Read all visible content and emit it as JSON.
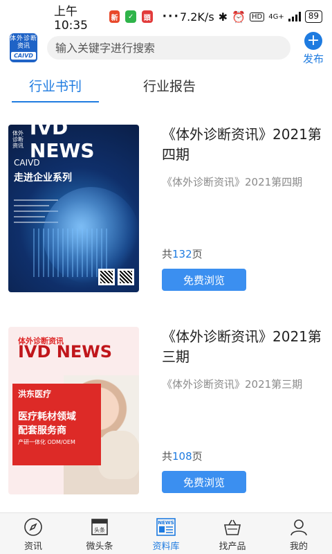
{
  "status_bar": {
    "time": "上午10:35",
    "app_icons": [
      {
        "name": "news-app-icon",
        "color": "#e8492b",
        "glyph": "新"
      },
      {
        "name": "wechat-icon",
        "color": "#2fb44a",
        "glyph": "✓"
      },
      {
        "name": "red-app-icon",
        "color": "#e23b3b",
        "glyph": "頭"
      }
    ],
    "more": "···",
    "net_speed": "7.2K/s",
    "hd": "HD",
    "network": "4G+",
    "battery": "89"
  },
  "header": {
    "logo_line1": "体外诊断",
    "logo_line2": "资讯",
    "logo_line3": "CAIVD",
    "search_placeholder": "输入关键字进行搜索",
    "publish_label": "发布",
    "publish_icon": "+"
  },
  "tabs": [
    {
      "label": "行业书刊",
      "active": true
    },
    {
      "label": "行业报告",
      "active": false
    }
  ],
  "items": [
    {
      "title": "《体外诊断资讯》2021第四期",
      "subtitle": "《体外诊断资讯》2021第四期",
      "pages_prefix": "共",
      "pages": "132",
      "pages_suffix": "页",
      "button": "免费浏览",
      "cover": {
        "small_text": "体外诊断资讯",
        "headline": "IVD NEWS",
        "caivd": "CAIVD",
        "series": "走进企业系列"
      }
    },
    {
      "title": "《体外诊断资讯》2021第三期",
      "subtitle": "《体外诊断资讯》2021第三期",
      "pages_prefix": "共",
      "pages": "108",
      "pages_suffix": "页",
      "button": "免费浏览",
      "cover": {
        "small_text": "体外诊断资讯",
        "headline": "IVD NEWS",
        "brand": "洪东医疗",
        "line1": "医疗耗材领域",
        "line2": "配套服务商",
        "line3": "产研一体化 ODM/OEM"
      }
    }
  ],
  "bottom_nav": [
    {
      "label": "资讯",
      "icon": "compass-icon",
      "active": false
    },
    {
      "label": "微头条",
      "icon": "headline-icon",
      "active": false
    },
    {
      "label": "资料库",
      "icon": "news-icon",
      "active": true
    },
    {
      "label": "找产品",
      "icon": "basket-icon",
      "active": false
    },
    {
      "label": "我的",
      "icon": "user-icon",
      "active": false
    }
  ],
  "colors": {
    "accent": "#1e7be0",
    "button": "#3b8ff0"
  }
}
